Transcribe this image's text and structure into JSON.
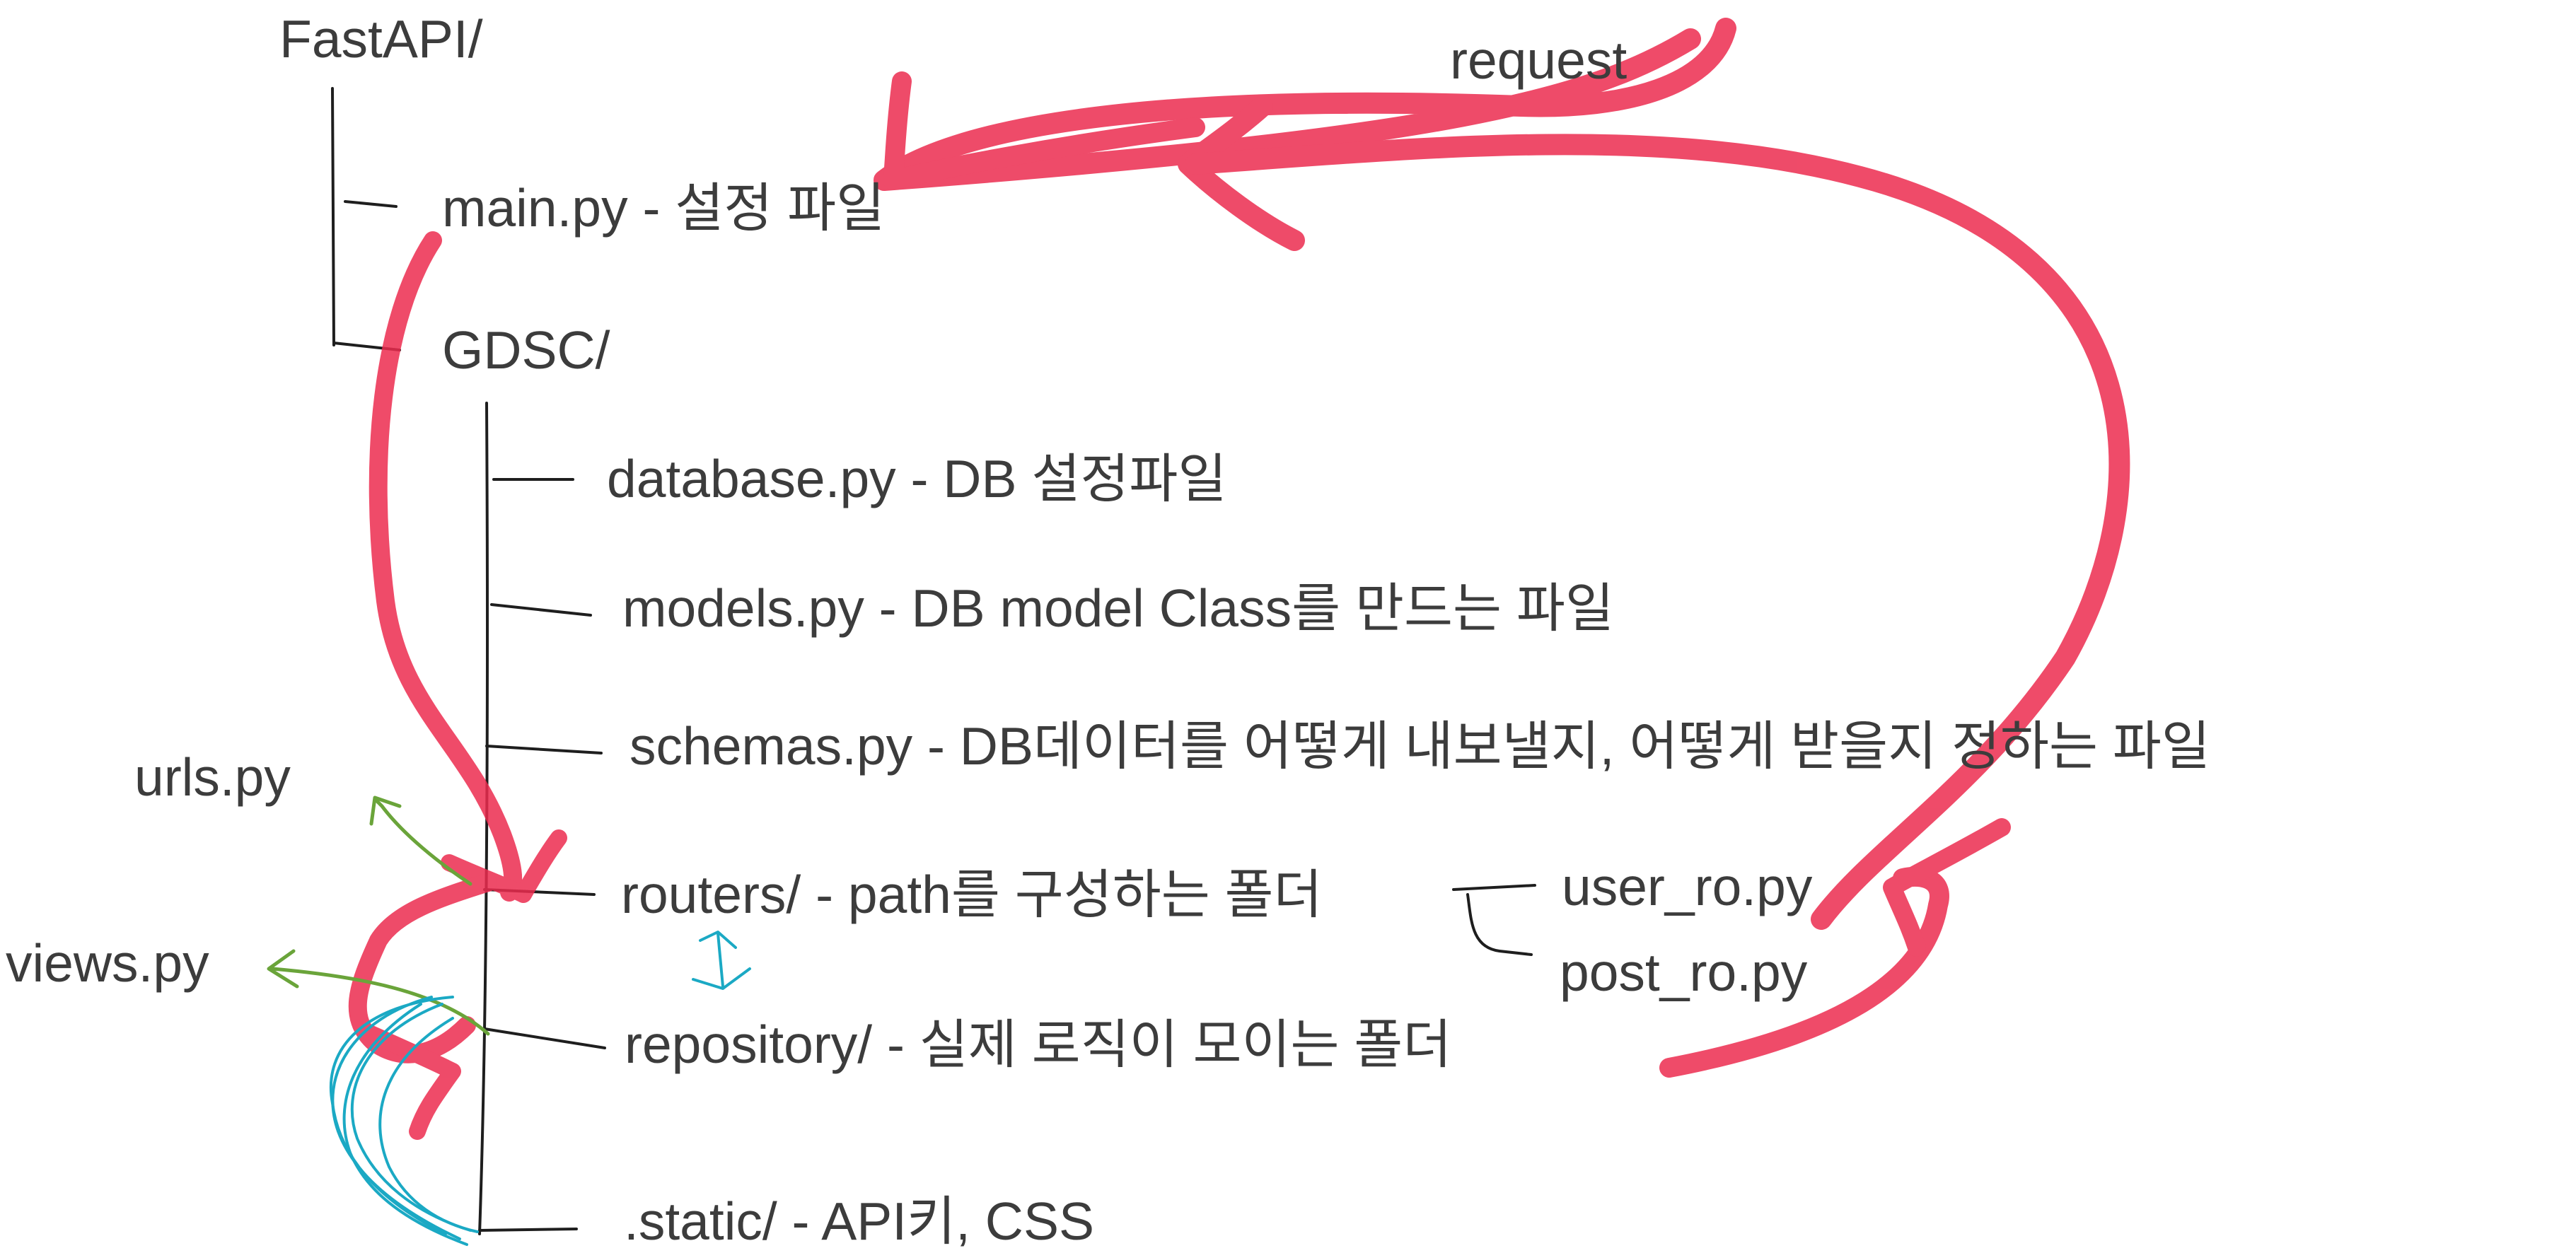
{
  "tree": {
    "root": "FastAPI/",
    "main": "main.py - 설정 파일",
    "package": "GDSC/",
    "database": "database.py - DB 설정파일",
    "models": "models.py - DB model Class를 만드는 파일",
    "schemas": "schemas.py - DB데이터를 어떻게 내보낼지, 어떻게 받을지 정하는 파일",
    "routers": "routers/ - path를 구성하는 폴더",
    "repository": "repository/ - 실제 로직이 모이는 폴더",
    "static": ".static/ - API키, CSS",
    "router_files": [
      "user_ro.py",
      "post_ro.py"
    ]
  },
  "annotations": {
    "request": "request",
    "urls": "urls.py",
    "views": "views.py"
  },
  "colors": {
    "text": "#3c3c3c",
    "tree_lines": "#1e1e1e",
    "request_flow": "#ec2c4f",
    "django_equivalent": "#6aa43a",
    "relation": "#1ba9c4"
  }
}
